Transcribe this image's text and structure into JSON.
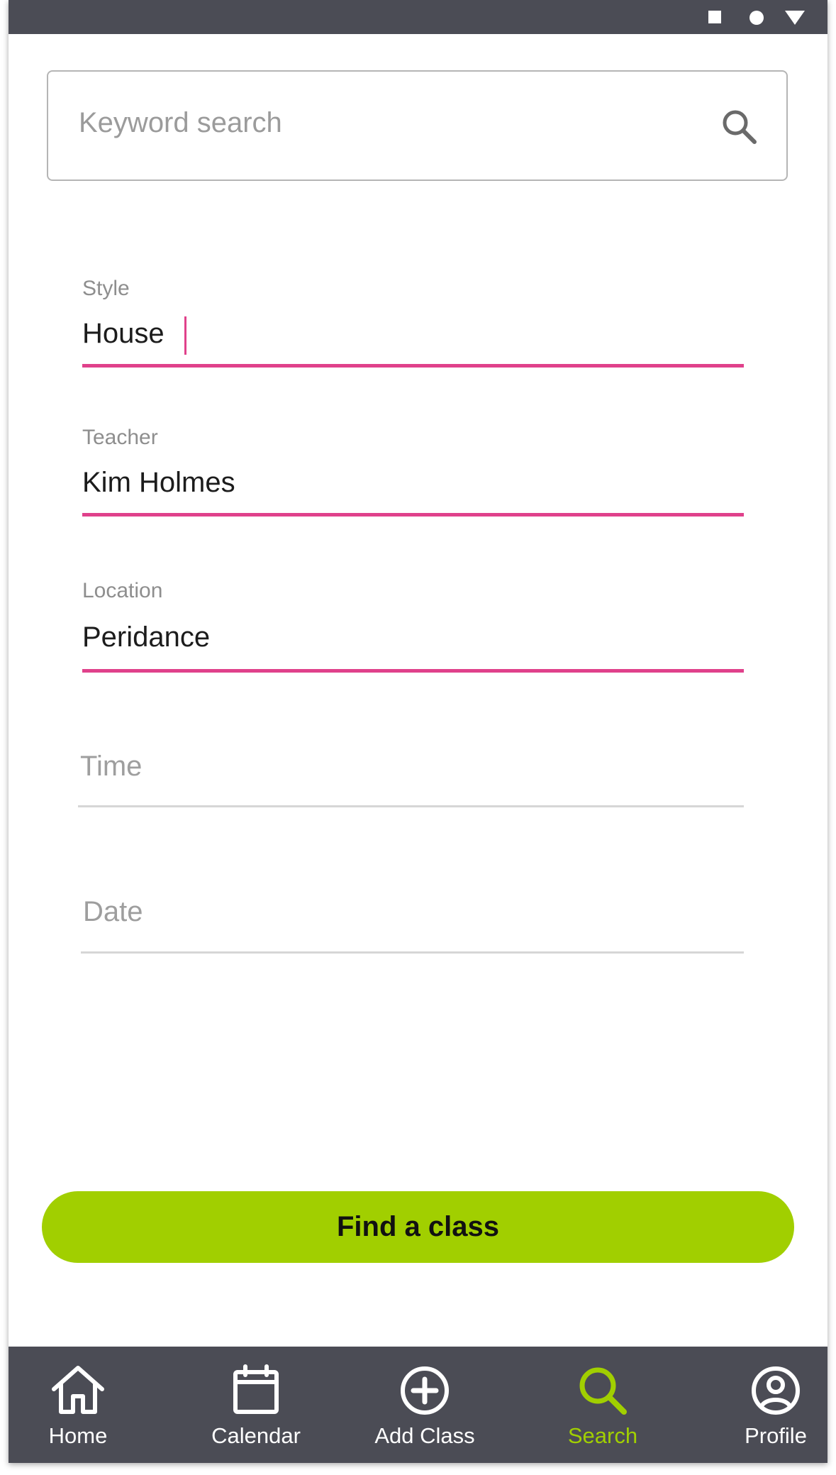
{
  "status_bar": {
    "icons": [
      "square-icon",
      "circle-icon",
      "triangle-icon"
    ]
  },
  "search": {
    "placeholder": "Keyword search",
    "icon": "search-icon"
  },
  "form": {
    "fields": [
      {
        "label": "Style",
        "value": "House",
        "active": true
      },
      {
        "label": "Teacher",
        "value": "Kim Holmes",
        "active": true
      },
      {
        "label": "Location",
        "value": "Peridance",
        "active": true
      },
      {
        "placeholder": "Time",
        "active": false
      },
      {
        "placeholder": "Date",
        "active": false
      }
    ]
  },
  "button": {
    "label": "Find a class"
  },
  "bottom_nav": {
    "items": [
      {
        "label": "Home",
        "icon": "home-icon",
        "active": false
      },
      {
        "label": "Calendar",
        "icon": "calendar-icon",
        "active": false
      },
      {
        "label": "Add Class",
        "icon": "add-circle-icon",
        "active": false
      },
      {
        "label": "Search",
        "icon": "search-icon",
        "active": true
      },
      {
        "label": "Profile",
        "icon": "profile-icon",
        "active": false
      }
    ]
  },
  "colors": {
    "accent_pink": "#e0418b",
    "accent_green": "#a1cf00",
    "bar_dark": "#4b4c55"
  }
}
